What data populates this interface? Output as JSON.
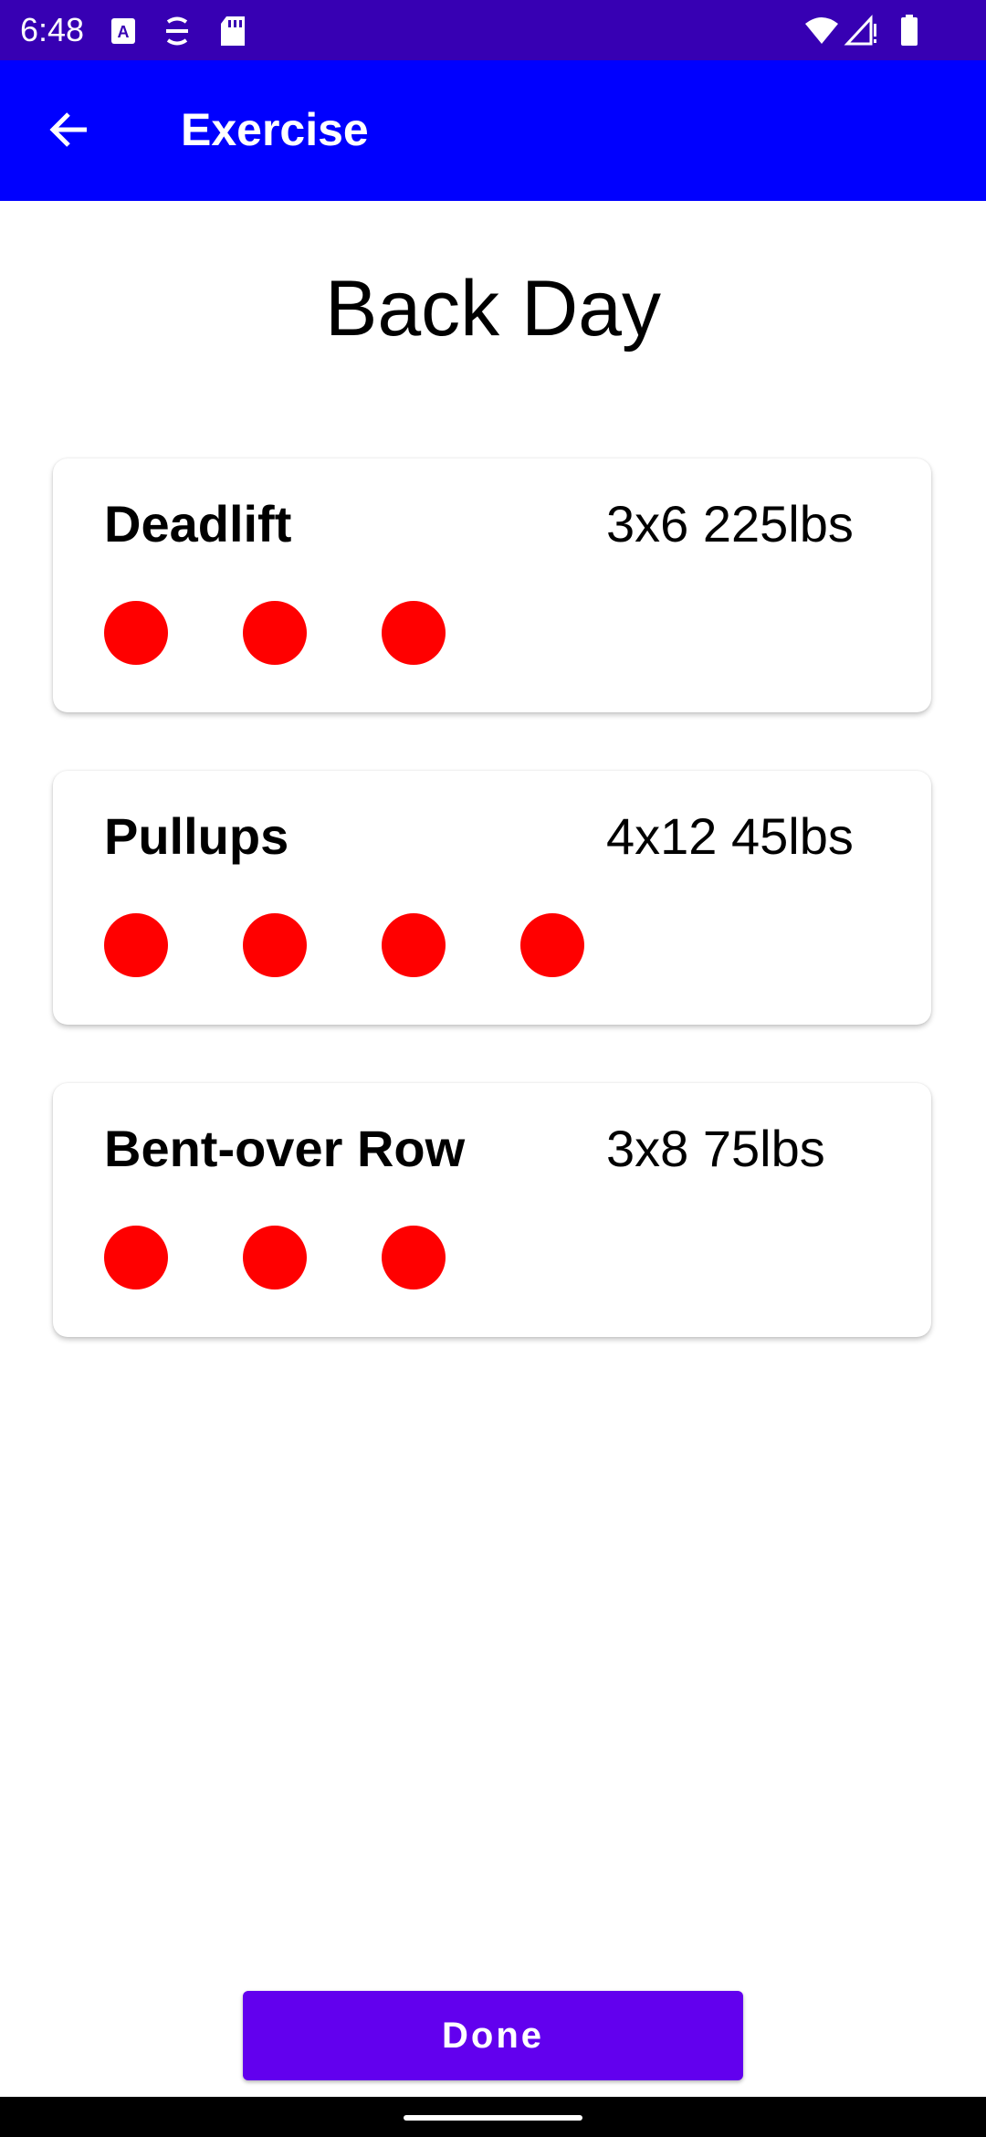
{
  "status_bar": {
    "time": "6:48",
    "icons": [
      "keyboard-a-icon",
      "accessibility-icon",
      "sd-card-icon",
      "wifi-icon",
      "signal-icon",
      "battery-icon"
    ]
  },
  "app_bar": {
    "title": "Exercise",
    "back_icon": "arrow-back-icon"
  },
  "workout": {
    "title": "Back Day"
  },
  "exercises": [
    {
      "name": "Deadlift",
      "detail": "3x6 225lbs",
      "sets": 3
    },
    {
      "name": "Pullups",
      "detail": "4x12 45lbs",
      "sets": 4
    },
    {
      "name": "Bent-over Row",
      "detail": "3x8 75lbs",
      "sets": 3
    }
  ],
  "done_button": {
    "label": "Done"
  },
  "colors": {
    "status_bar": "#3700b3",
    "app_bar": "#0000ff",
    "set_dot": "#ff0000",
    "done_button": "#6200ee"
  }
}
